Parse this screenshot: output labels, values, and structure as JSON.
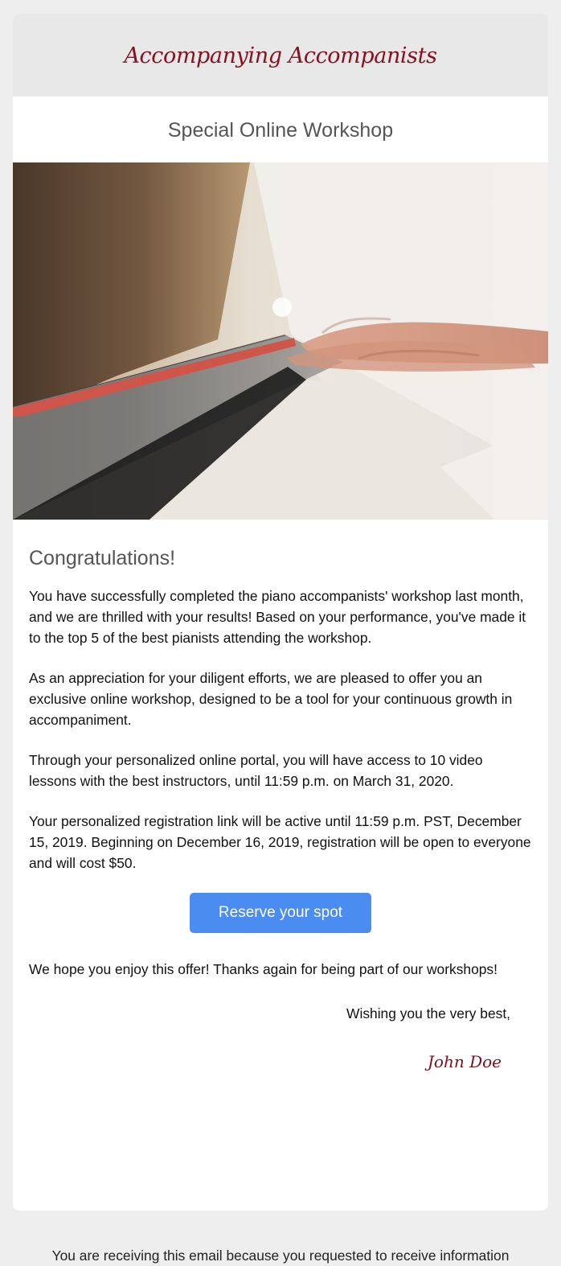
{
  "header": {
    "brand": "Accompanying Accompanists",
    "subtitle": "Special Online Workshop"
  },
  "hero_image": {
    "name": "piano-hands-photo"
  },
  "body": {
    "headline": "Congratulations!",
    "paragraphs": [
      "You have successfully completed the piano accompanists' workshop last month, and we are thrilled with your results! Based on your performance, you've made it to the top 5 of the best pianists attending the workshop.",
      "As an appreciation for your diligent efforts, we are pleased to offer you an exclusive online workshop, designed to be a tool for your continuous growth in accompaniment.",
      "Through your personalized online portal, you will have access to 10 video lessons with the best instructors, until 11:59 p.m. on March 31, 2020.",
      "Your personalized registration link will be active until 11:59 p.m. PST, December 15, 2019. Beginning on December 16, 2019, registration will be open to everyone and will cost $50."
    ],
    "cta_label": "Reserve your spot",
    "closing": "We hope you enjoy this offer! Thanks again for being part of our workshops!",
    "signoff": "Wishing you the very best,",
    "signature": "John Doe"
  },
  "footer": {
    "text": "You are receiving this email because you requested to receive information"
  },
  "colors": {
    "brand": "#8a1020",
    "button": "#4a8cf0",
    "page_background": "#eeeeee"
  }
}
